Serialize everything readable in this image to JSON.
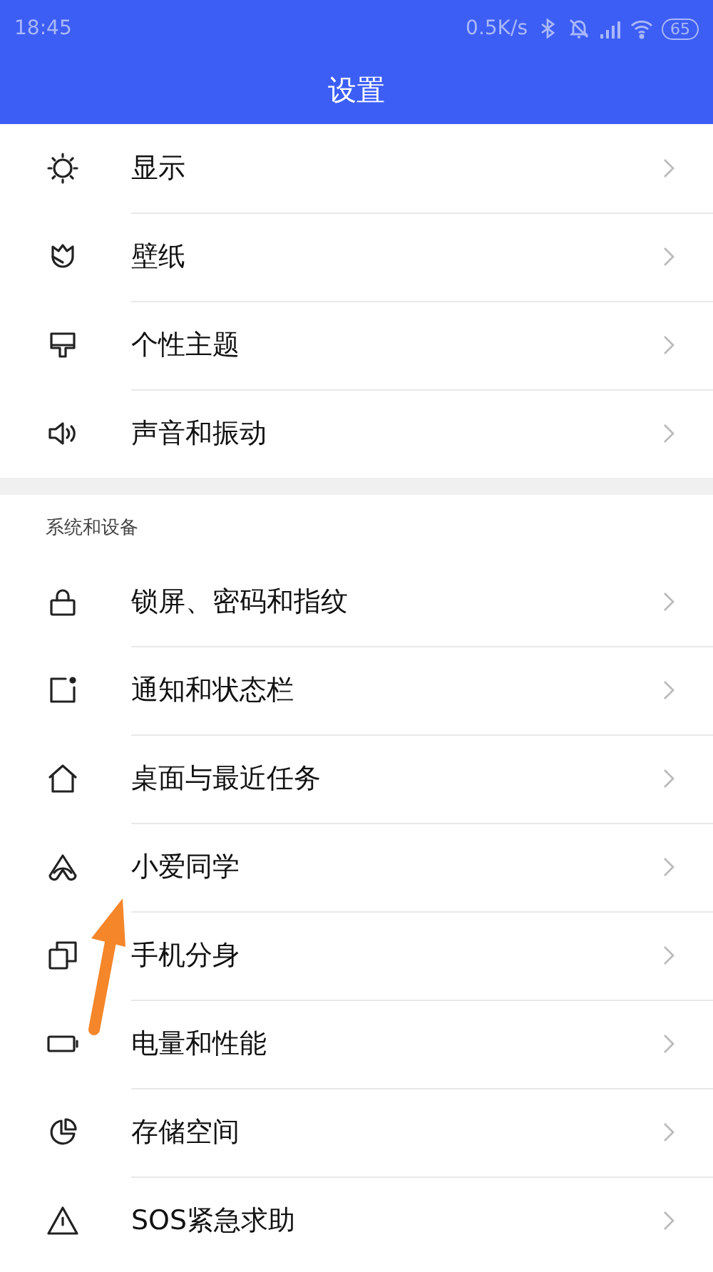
{
  "status_bar": {
    "time": "18:45",
    "speed": "0.5K/s",
    "battery": "65"
  },
  "title": "设置",
  "groups": [
    {
      "items": [
        {
          "label": "显示"
        },
        {
          "label": "壁纸"
        },
        {
          "label": "个性主题"
        },
        {
          "label": "声音和振动"
        }
      ]
    },
    {
      "header": "系统和设备",
      "items": [
        {
          "label": "锁屏、密码和指纹"
        },
        {
          "label": "通知和状态栏"
        },
        {
          "label": "桌面与最近任务"
        },
        {
          "label": "小爱同学"
        },
        {
          "label": "手机分身"
        },
        {
          "label": "电量和性能"
        },
        {
          "label": "存储空间"
        },
        {
          "label": "SOS紧急求助"
        }
      ]
    }
  ]
}
